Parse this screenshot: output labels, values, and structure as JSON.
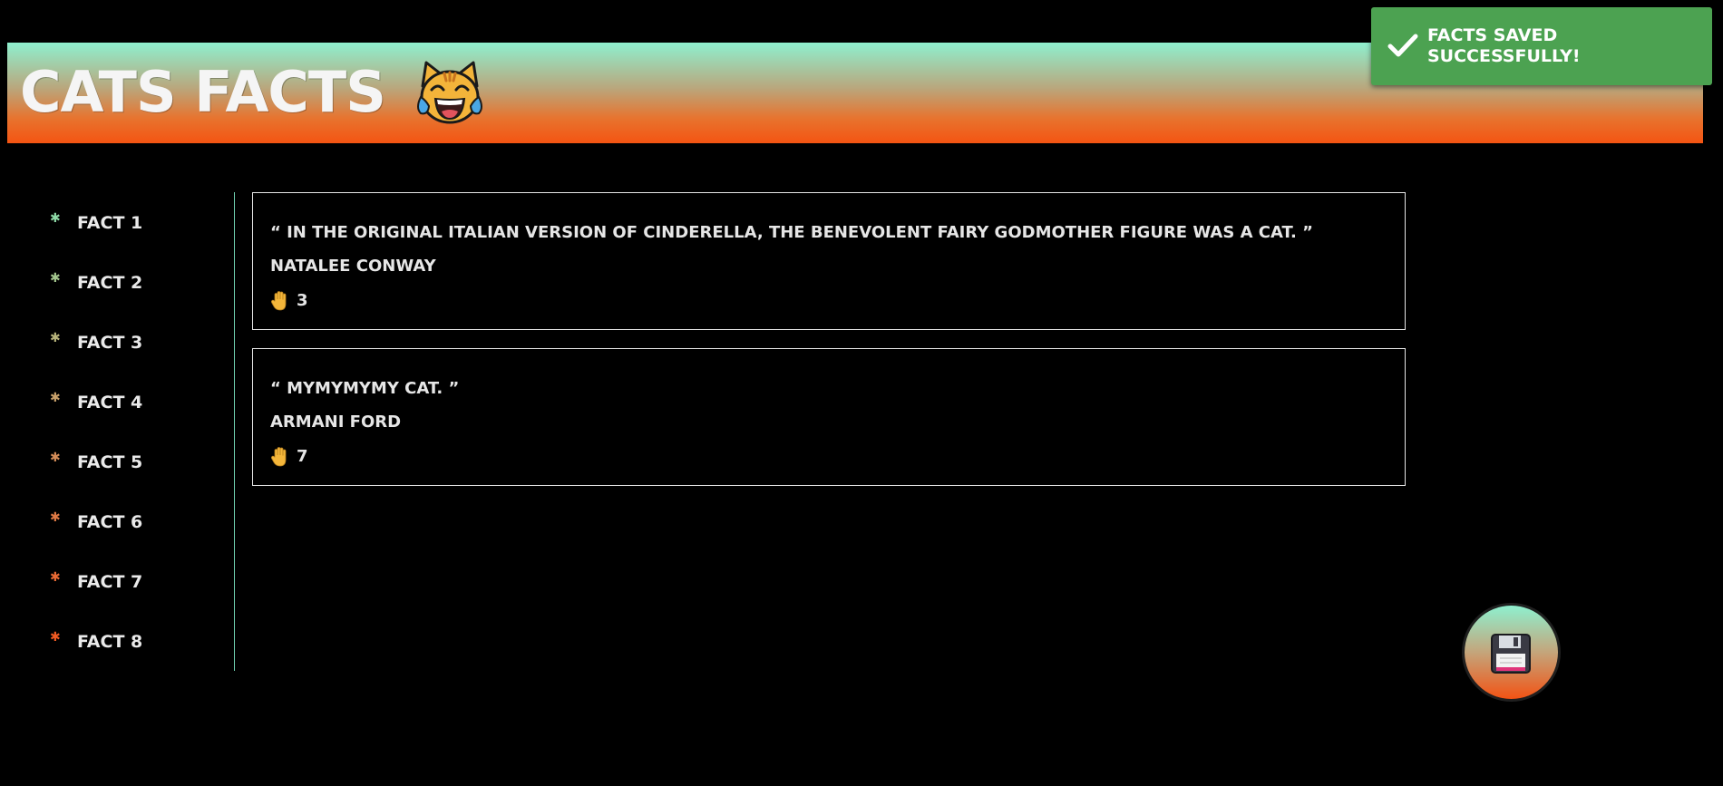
{
  "header": {
    "title": "CATS FACTS",
    "emoji_icon": "cat-with-tears-of-joy-icon"
  },
  "toast": {
    "message": "FACTS SAVED SUCCESSFULLY!",
    "icon": "checkmark-icon",
    "color": "#4ca251"
  },
  "sidebar": {
    "items": [
      {
        "label": "FACT 1",
        "bullet_color": "#8ed9a6"
      },
      {
        "label": "FACT 2",
        "bullet_color": "#a3c58d"
      },
      {
        "label": "FACT 3",
        "bullet_color": "#b7b37b"
      },
      {
        "label": "FACT 4",
        "bullet_color": "#c8a16b"
      },
      {
        "label": "FACT 5",
        "bullet_color": "#d38c58"
      },
      {
        "label": "FACT 6",
        "bullet_color": "#df7a45"
      },
      {
        "label": "FACT 7",
        "bullet_color": "#e86a34"
      },
      {
        "label": "FACT 8",
        "bullet_color": "#f05a22"
      }
    ]
  },
  "facts": [
    {
      "quote": "“ IN THE ORIGINAL ITALIAN VERSION OF CINDERELLA, THE BENEVOLENT FAIRY GODMOTHER FIGURE WAS A CAT. ”",
      "author": "NATALEE CONWAY",
      "votes": "3"
    },
    {
      "quote": "“ MYMYMYMY CAT. ”",
      "author": "ARMANI FORD",
      "votes": "7"
    }
  ],
  "save_button": {
    "icon": "floppy-disk-icon"
  },
  "colors": {
    "background": "#000000",
    "header_gradient_top": "#8ef0cf",
    "header_gradient_bottom": "#f45412",
    "divider": "#6fd0b0"
  }
}
